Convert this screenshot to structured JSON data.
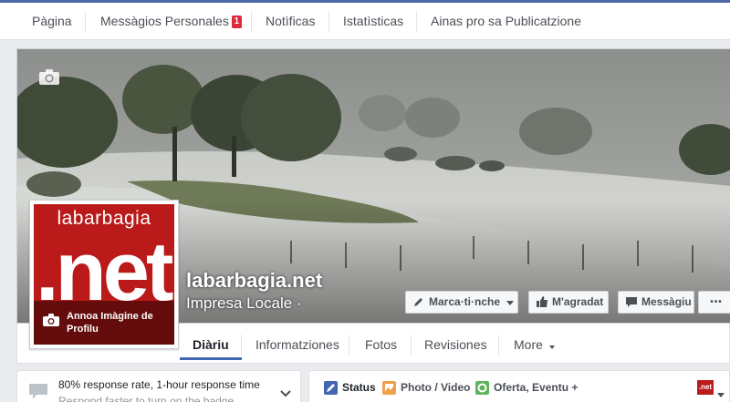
{
  "topnav": {
    "items": [
      "Pàgina",
      "Messàgios Personales",
      "Notìficas",
      "Istatìsticas",
      "Ainas pro sa Publicatzione"
    ],
    "messages_badge": "1"
  },
  "page": {
    "name": "labarbagia.net",
    "category": "Impresa Locale ·",
    "profile_logo_top": "labarbagia",
    "profile_logo_net": ".net",
    "add_profile_label": "Annoa Imàgine de Profilu"
  },
  "actions": {
    "tag": "Marca·ti·nche",
    "like": "M'agradat",
    "message": "Messàgiu",
    "more": "•••"
  },
  "tabs": [
    "Diàriu",
    "Informatziones",
    "Fotos",
    "Revisiones",
    "More"
  ],
  "active_tab": "Diàriu",
  "response": {
    "rate": "80% response rate, 1-hour response time",
    "hint": "Respond faster to turn on the badge"
  },
  "composer": {
    "status": "Status",
    "photo": "Photo / Video",
    "offer": "Oferta, Eventu +",
    "avatar_label": ".net"
  },
  "colors": {
    "brand": "#4b69a8",
    "tab_active": "#4267b2",
    "logo_red": "#ba1a1a",
    "badge": "#e0283c"
  }
}
